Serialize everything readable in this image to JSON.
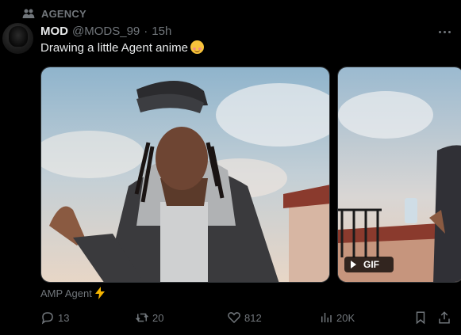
{
  "context": {
    "label": "AGENCY",
    "icon": "people-icon"
  },
  "author": {
    "name": "MOD",
    "handle": "@MODS_99",
    "separator": "·",
    "time": "15h"
  },
  "tweet": {
    "text": "Drawing a little Agent anime",
    "emoji": "smiling-face-with-blush"
  },
  "media": [
    {
      "type": "image",
      "description_name": "anime-character-illustration"
    },
    {
      "type": "gif",
      "badge": "GIF"
    }
  ],
  "caption": {
    "text": "AMP Agent",
    "emoji": "lightning-bolt"
  },
  "actions": {
    "replies": "13",
    "reposts": "20",
    "likes": "812",
    "views": "20K"
  },
  "colors": {
    "background": "#000000",
    "text": "#e7e9ea",
    "muted": "#71767b",
    "lightning": "#f5b400"
  }
}
